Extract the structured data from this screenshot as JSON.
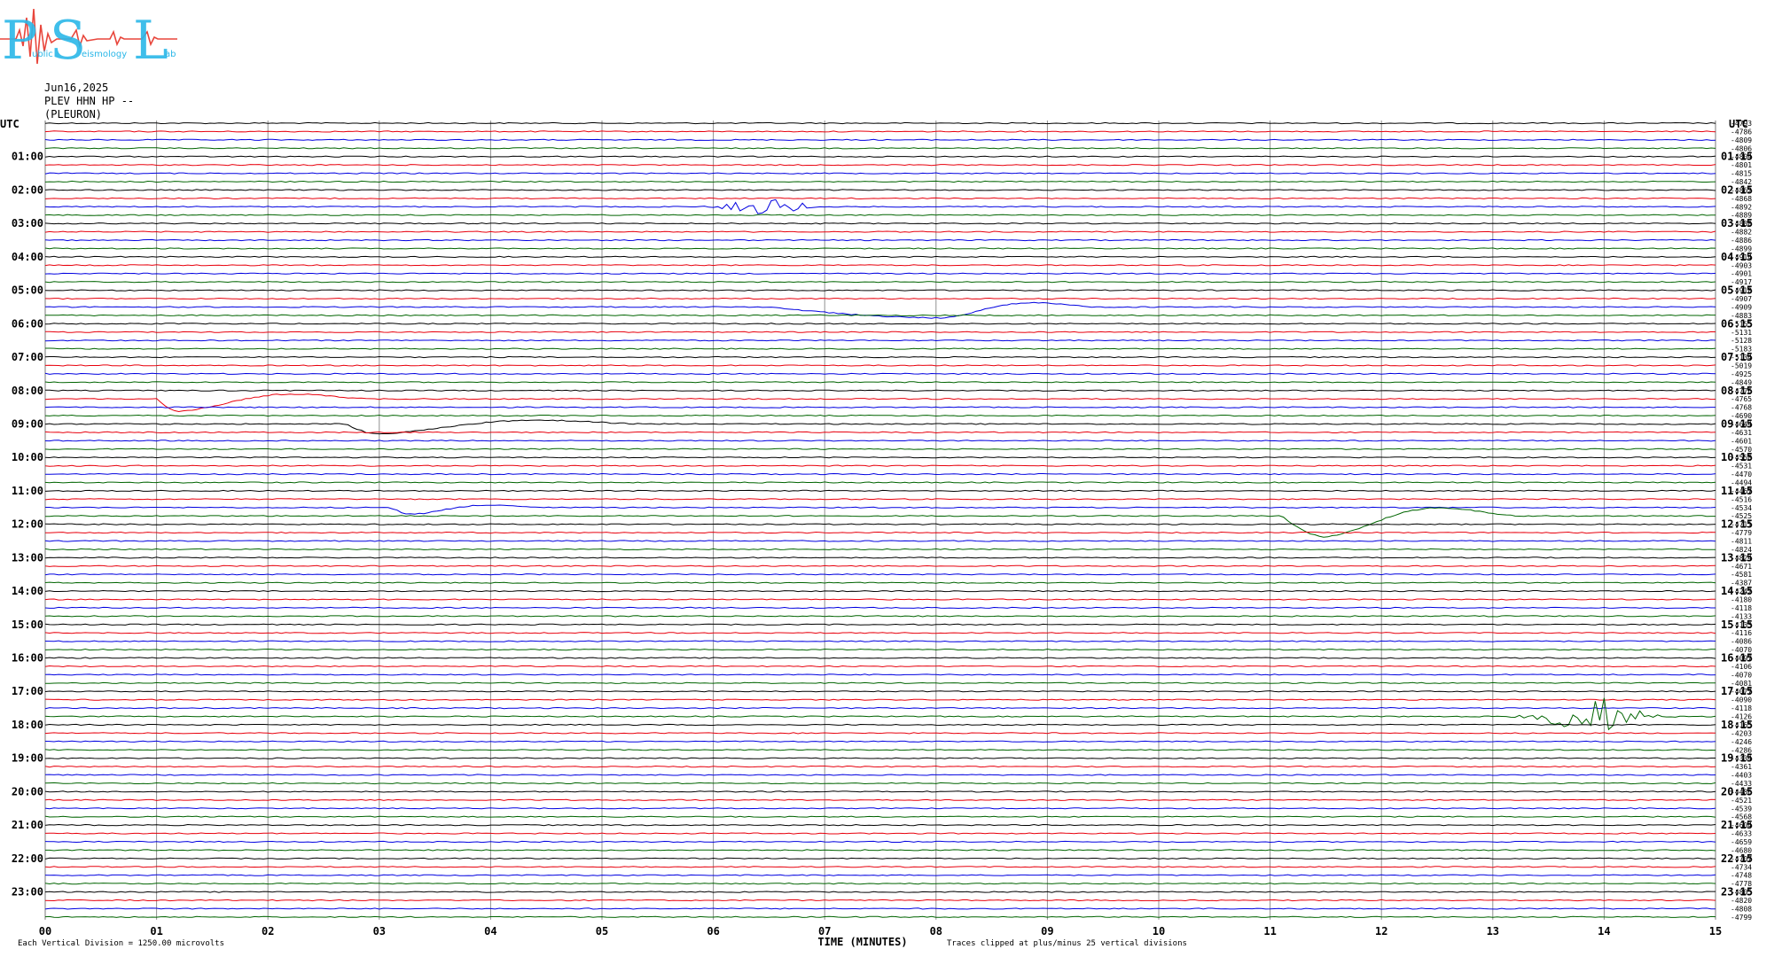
{
  "header": {
    "date": "Jun16,2025",
    "station_line": "PLEV HHN HP --",
    "site": "(PLEURON)"
  },
  "logo": {
    "text": "PSL",
    "small_words": [
      "ublic",
      "eismology",
      "ab"
    ],
    "text_color": "#2ab7e8",
    "signal_color": "#e8463c"
  },
  "chart_data": {
    "type": "line",
    "title": "",
    "xlabel": "TIME (MINUTES)",
    "ylabel": "",
    "left_axis_title": "UTC",
    "right_axis_title": "UTC",
    "x_ticks": [
      "00",
      "01",
      "02",
      "03",
      "04",
      "05",
      "06",
      "07",
      "08",
      "09",
      "10",
      "11",
      "12",
      "13",
      "14",
      "15"
    ],
    "xlim": [
      0,
      15
    ],
    "left_hour_labels": [
      "01:00",
      "02:00",
      "03:00",
      "04:00",
      "05:00",
      "06:00",
      "07:00",
      "08:00",
      "09:00",
      "10:00",
      "11:00",
      "12:00",
      "13:00",
      "14:00",
      "15:00",
      "16:00",
      "17:00",
      "18:00",
      "19:00",
      "20:00",
      "21:00",
      "22:00",
      "23:00"
    ],
    "right_hour_labels": [
      "01:15",
      "02:15",
      "03:15",
      "04:15",
      "05:15",
      "06:15",
      "07:15",
      "08:15",
      "09:15",
      "10:15",
      "11:15",
      "12:15",
      "13:15",
      "14:15",
      "15:15",
      "16:15",
      "17:15",
      "18:15",
      "19:15",
      "20:15",
      "21:15",
      "22:15",
      "23:15"
    ],
    "trace_colors": [
      "#000000",
      "#e8000d",
      "#0000e0",
      "#006400"
    ],
    "trace_count": 96,
    "minutes_per_trace": 15,
    "right_offsets": [
      "-4793",
      "-4786",
      "-4809",
      "-4806",
      "-4804",
      "-4801",
      "-4815",
      "-4842",
      "-4862",
      "-4868",
      "-4892",
      "-4889",
      "-4880",
      "-4882",
      "-4886",
      "-4899",
      "-4914",
      "-4903",
      "-4901",
      "-4917",
      "-4910",
      "-4907",
      "-4909",
      "-4883",
      "-5155",
      "-5131",
      "-5128",
      "-5183",
      "-5134",
      "-5019",
      "-4925",
      "-4849",
      "-4776",
      "-4765",
      "-4768",
      "-4690",
      "-4644",
      "-4631",
      "-4601",
      "-4570",
      "-4558",
      "-4531",
      "-4470",
      "-4494",
      "-4467",
      "-4516",
      "-4534",
      "-4525",
      "-4711",
      "-4779",
      "-4811",
      "-4824",
      "-4824",
      "-4671",
      "-4581",
      "-4387",
      "-4242",
      "-4180",
      "-4118",
      "-4133",
      "-4133",
      "-4116",
      "-4086",
      "-4070",
      "-4097",
      "-4106",
      "-4070",
      "-4081",
      "-4077",
      "-4090",
      "-4118",
      "-4126",
      "-4165",
      "-4203",
      "-4246",
      "-4286",
      "-4334",
      "-4361",
      "-4403",
      "-4433",
      "-4486",
      "-4521",
      "-4539",
      "-4568",
      "-4604",
      "-4633",
      "-4659",
      "-4680",
      "-4707",
      "-4734",
      "-4748",
      "-4778",
      "-4805",
      "-4820",
      "-4808",
      "-4799"
    ],
    "events": [
      {
        "trace": 10,
        "start_min": 5.7,
        "end_min": 7.6,
        "peak_min": 6.5,
        "amplitude_divisions": 0.9,
        "kind": "burst"
      },
      {
        "trace": 22,
        "start_min": 6.5,
        "end_min": 9.5,
        "peak_min": 8.05,
        "amplitude_divisions": 1.3,
        "kind": "long-period"
      },
      {
        "trace": 33,
        "start_min": 1.0,
        "end_min": 3.0,
        "peak_min": 1.2,
        "amplitude_divisions": 1.5,
        "kind": "long-period"
      },
      {
        "trace": 36,
        "start_min": 2.7,
        "end_min": 5.5,
        "peak_min": 3.0,
        "amplitude_divisions": 1.2,
        "kind": "long-period"
      },
      {
        "trace": 46,
        "start_min": 3.1,
        "end_min": 4.5,
        "peak_min": 3.3,
        "amplitude_divisions": 0.8,
        "kind": "long-period"
      },
      {
        "trace": 47,
        "start_min": 11.1,
        "end_min": 13.3,
        "peak_min": 11.5,
        "amplitude_divisions": 2.5,
        "kind": "long-period"
      },
      {
        "trace": 71,
        "start_min": 13.1,
        "end_min": 15.0,
        "peak_min": 13.9,
        "amplitude_divisions": 2.5,
        "kind": "burst"
      }
    ],
    "footer_left": "Each Vertical Division = 1250.00 microvolts",
    "footer_right": "Traces clipped at plus/minus 25 vertical divisions",
    "grid": true
  }
}
